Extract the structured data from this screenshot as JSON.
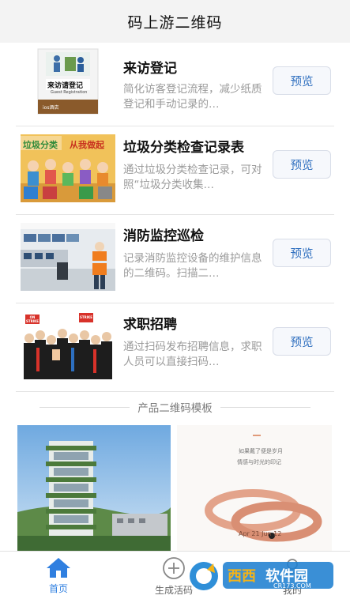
{
  "header": {
    "title": "码上游二维码"
  },
  "items": [
    {
      "title": "来访登记",
      "desc": "简化访客登记流程，减少纸质登记和手动记录的…",
      "button": "预览",
      "thumb": {
        "sign_title": "来访请登记",
        "sign_sub": "Guest Registration",
        "brand": "ios酒店"
      }
    },
    {
      "title": "垃圾分类检查记录表",
      "desc": "通过垃圾分类检查记录，可对照“垃圾分类收集…",
      "button": "预览",
      "thumb": {
        "banner_left": "垃圾分类",
        "banner_right": "从我做起"
      }
    },
    {
      "title": "消防监控巡检",
      "desc": "记录消防监控设备的维护信息的二维码。扫描二…",
      "button": "预览"
    },
    {
      "title": "求职招聘",
      "desc": "通过扫码发布招聘信息，求职人员可以直接扫码…",
      "button": "预览",
      "thumb": {
        "sign_left": "ON STRIKE",
        "sign_right": "STRIKE"
      }
    }
  ],
  "section": {
    "label": "产品二维码模板"
  },
  "templates": {
    "right_text_1": "如果戴了便是岁月",
    "right_text_2": "情感与时光的印记",
    "ring_text": "Apr 21 Jun 12"
  },
  "tabbar": [
    {
      "label": "首页",
      "active": true
    },
    {
      "label": "生成活码",
      "active": false
    },
    {
      "label": "我的",
      "active": false
    }
  ],
  "watermark": {
    "text": "软件园",
    "brand": "西西",
    "domain": "CR173.COM"
  },
  "colors": {
    "accent": "#2f7fe0",
    "header_bg": "#f3f3f3",
    "button_text": "#2f6fbf"
  }
}
